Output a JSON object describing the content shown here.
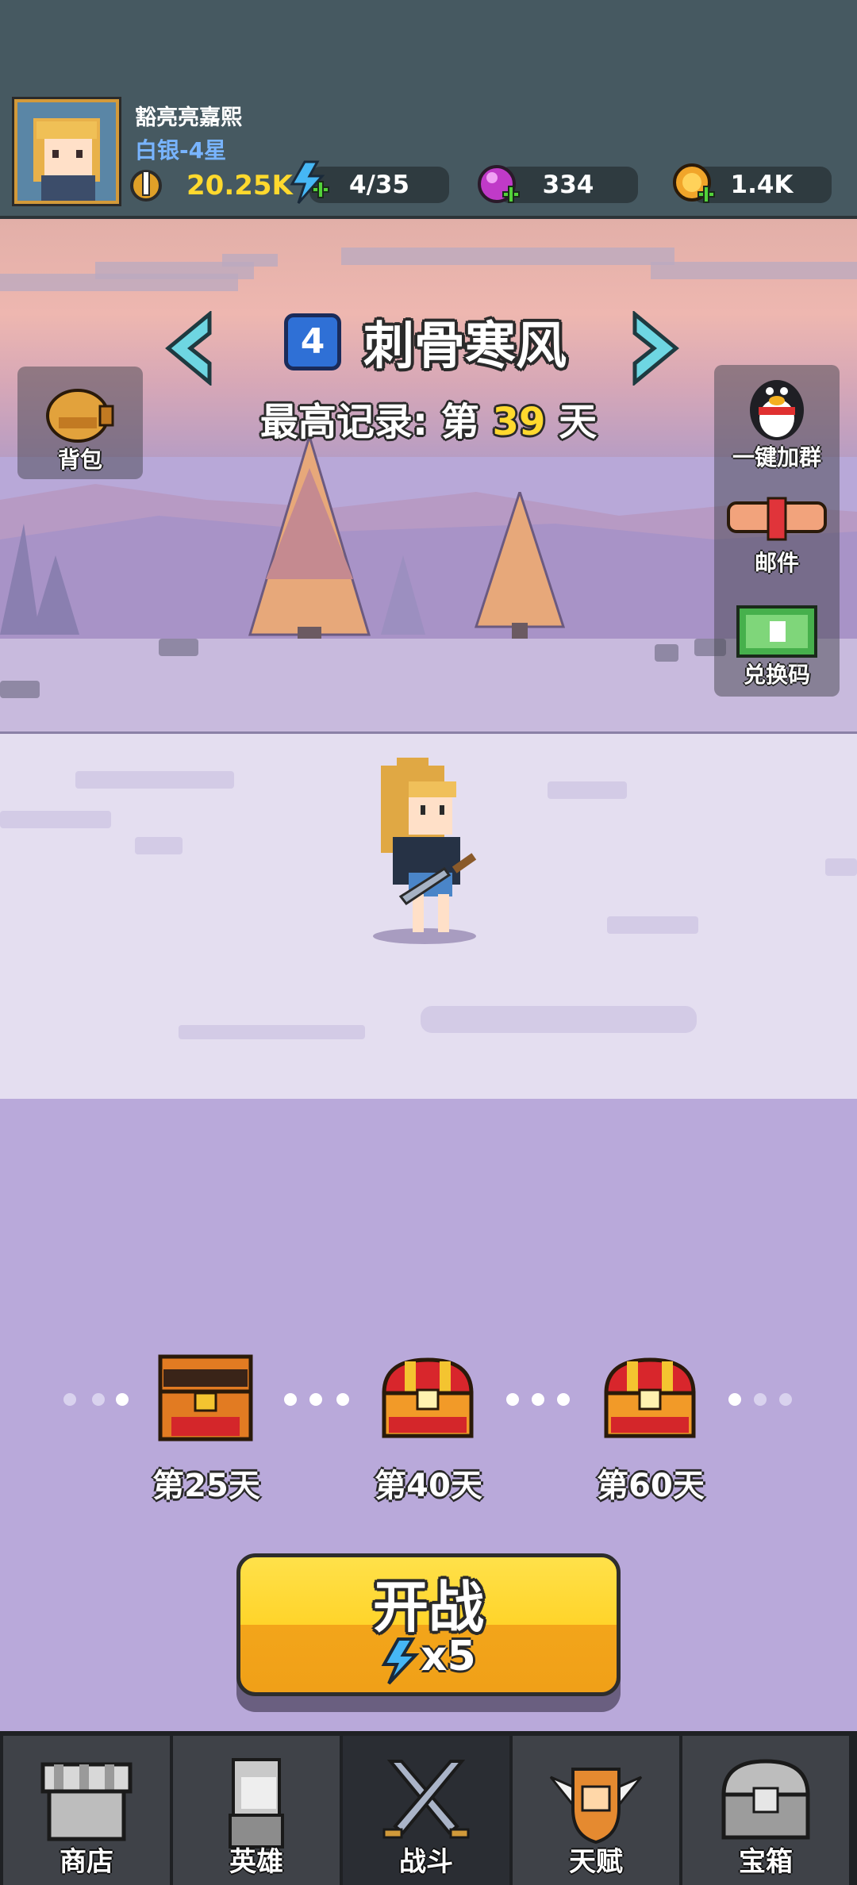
{
  "player": {
    "name": "豁亮亮嘉熙",
    "rank": "白银-4星",
    "power": "20.25K"
  },
  "resources": {
    "energy": "4/35",
    "gems": "334",
    "gold": "1.4K"
  },
  "stage": {
    "number": "4",
    "title": "刺骨寒风",
    "record_prefix": "最高记录: 第",
    "record_day": "39",
    "record_suffix": "天"
  },
  "side_left": {
    "backpack": "背包"
  },
  "side_right": {
    "join_group": "一键加群",
    "mail": "邮件",
    "redeem_code": "兑换码"
  },
  "rewards": [
    {
      "label": "第25天",
      "state": "unlocked"
    },
    {
      "label": "第40天",
      "state": "locked"
    },
    {
      "label": "第60天",
      "state": "locked"
    }
  ],
  "start_button": {
    "label": "开战",
    "cost": "x5"
  },
  "nav": [
    {
      "label": "商店",
      "icon": "shop-icon"
    },
    {
      "label": "英雄",
      "icon": "hero-icon"
    },
    {
      "label": "战斗",
      "icon": "crossed-swords-icon",
      "active": true
    },
    {
      "label": "天赋",
      "icon": "fist-wings-icon"
    },
    {
      "label": "宝箱",
      "icon": "treasure-chest-icon"
    }
  ],
  "colors": {
    "header_bg": "#465961",
    "accent_yellow": "#ffd92e",
    "rank_blue": "#78b4ff",
    "stage_blue": "#2f70d6"
  }
}
